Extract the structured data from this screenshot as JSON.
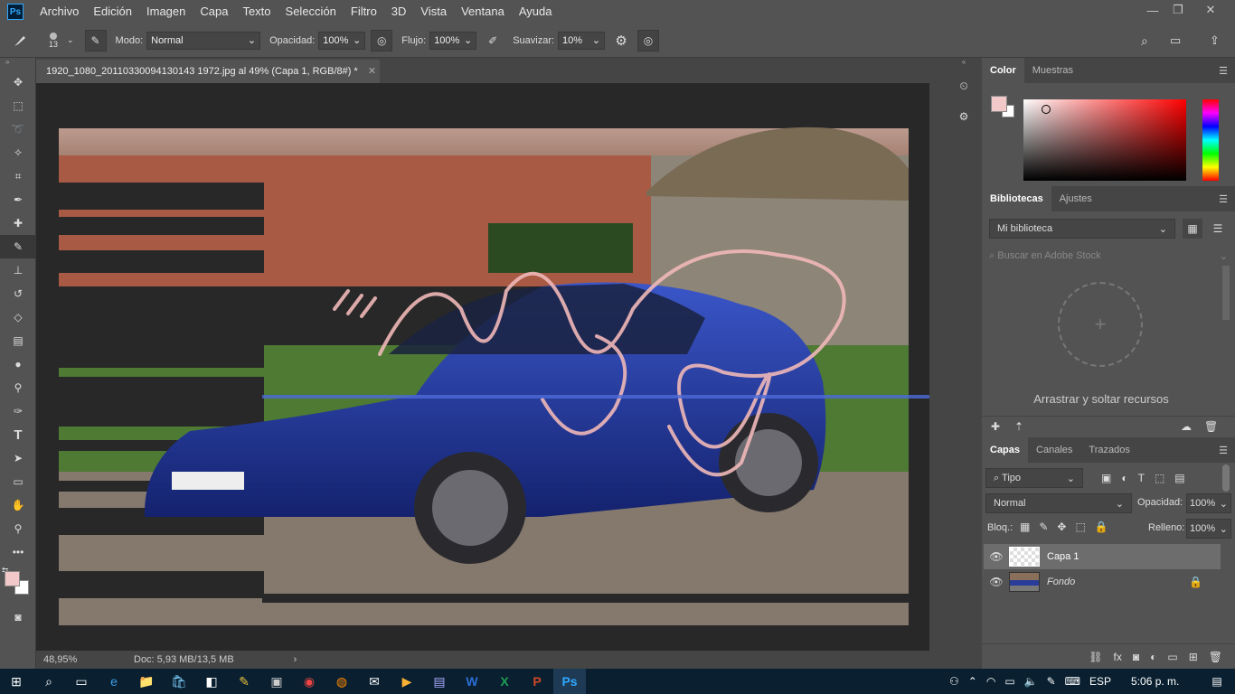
{
  "app": {
    "logo": "Ps"
  },
  "menu": [
    "Archivo",
    "Edición",
    "Imagen",
    "Capa",
    "Texto",
    "Selección",
    "Filtro",
    "3D",
    "Vista",
    "Ventana",
    "Ayuda"
  ],
  "options": {
    "brush_size": "13",
    "mode_label": "Modo:",
    "mode_value": "Normal",
    "opacity_label": "Opacidad:",
    "opacity_value": "100%",
    "flow_label": "Flujo:",
    "flow_value": "100%",
    "smoothing_label": "Suavizar:",
    "smoothing_value": "10%"
  },
  "document": {
    "tab_title": "1920_1080_20110330094130143 1972.jpg al 49% (Capa 1, RGB/8#) *",
    "zoom": "48,95%",
    "doc_info": "Doc: 5,93 MB/13,5 MB"
  },
  "color_panel": {
    "tabs": [
      "Color",
      "Muestras"
    ],
    "foreground": "#f2c8c8",
    "background": "#ffffff"
  },
  "libraries_panel": {
    "tabs": [
      "Bibliotecas",
      "Ajustes"
    ],
    "library": "Mi biblioteca",
    "search_placeholder": "Buscar en Adobe Stock",
    "drop_text": "Arrastrar y soltar recursos"
  },
  "layers_panel": {
    "tabs": [
      "Capas",
      "Canales",
      "Trazados"
    ],
    "filter_kind": "Tipo",
    "blend_mode": "Normal",
    "opacity_label": "Opacidad:",
    "opacity_value": "100%",
    "lock_label": "Bloq.:",
    "fill_label": "Relleno:",
    "fill_value": "100%",
    "layers": [
      {
        "name": "Capa 1",
        "selected": true
      },
      {
        "name": "Fondo",
        "selected": false,
        "locked": true
      }
    ]
  },
  "taskbar": {
    "language": "ESP",
    "time": "5:06 p. m."
  }
}
